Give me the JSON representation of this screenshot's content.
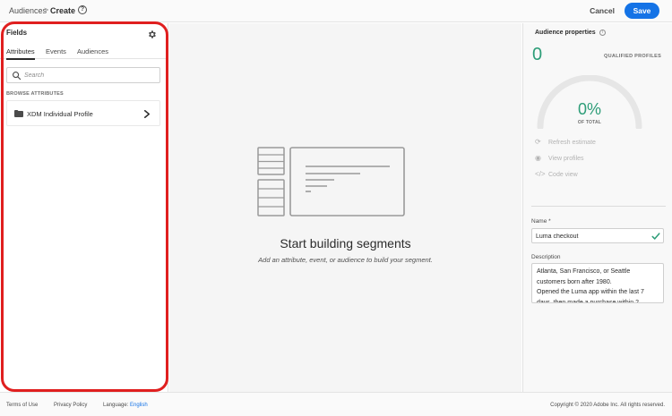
{
  "header": {
    "breadcrumb_root": "Audiences",
    "breadcrumb_separator": ">",
    "breadcrumb_current": "Create",
    "help_glyph": "?",
    "cancel_label": "Cancel",
    "save_label": "Save"
  },
  "left_panel": {
    "title": "Fields",
    "tabs": [
      {
        "label": "Attributes",
        "active": true
      },
      {
        "label": "Events",
        "active": false
      },
      {
        "label": "Audiences",
        "active": false
      }
    ],
    "search_placeholder": "Search",
    "browse_title": "BROWSE ATTRIBUTES",
    "items": [
      {
        "label": "XDM Individual Profile",
        "icon": "folder-icon"
      }
    ]
  },
  "canvas": {
    "empty_title": "Start building segments",
    "empty_subtitle": "Add an attribute, event, or audience to build your segment."
  },
  "right_panel": {
    "title": "Audience properties",
    "info_glyph": "i",
    "qualified_count": "0",
    "qualified_label": "QUALIFIED PROFILES",
    "percent": "0%",
    "percent_label": "OF TOTAL",
    "percent_value": 0,
    "actions": [
      {
        "label": "Refresh estimate",
        "icon": "refresh-icon"
      },
      {
        "label": "View profiles",
        "icon": "eye-icon"
      },
      {
        "label": "Code view",
        "icon": "code-icon"
      }
    ],
    "name_label": "Name *",
    "name_value": "Luma checkout",
    "description_label": "Description",
    "description_value": "Atlanta, San Francisco, or Seattle customers born after 1980.\nOpened the Luma app within the last 7 days, then made a purchase within 2"
  },
  "footer": {
    "terms": "Terms of Use",
    "privacy": "Privacy Policy",
    "language_label": "Language:",
    "language_value": "English",
    "copyright": "Copyright © 2020 Adobe Inc. All rights reserved."
  },
  "colors": {
    "accent": "#1473e6",
    "success": "#2d9d78",
    "highlight": "#e01f1f"
  }
}
